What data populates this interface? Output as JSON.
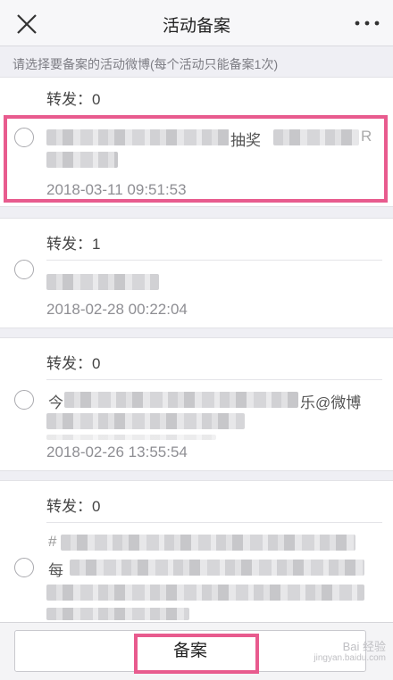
{
  "navbar": {
    "title": "活动备案",
    "close_icon": "close-icon",
    "more_icon": "more-horizontal-icon"
  },
  "hint": "请选择要备案的活动微博(每个活动只能备案1次)",
  "posts": [
    {
      "repost_label": "转发：0",
      "visible_text": "抽奖",
      "visible_text_suffix": "R",
      "time": "2018-03-11 09:51:53",
      "selected": false
    },
    {
      "repost_label": "转发：1",
      "time": "2018-02-28 00:22:04",
      "selected": false
    },
    {
      "repost_label": "转发：0",
      "visible_text_prefix": "今",
      "visible_text": "乐@微博",
      "time": "2018-02-26 13:55:54",
      "selected": false
    },
    {
      "repost_label": "转发：0",
      "visible_text_prefix": "#",
      "visible_text": "每",
      "selected": false
    }
  ],
  "bottom": {
    "archive_button": "备案",
    "watermark_line1": "Bai 经验",
    "watermark_line2": "jingyan.baidu.com"
  },
  "colors": {
    "highlight": "#e85b8e",
    "background": "#efeff4"
  }
}
